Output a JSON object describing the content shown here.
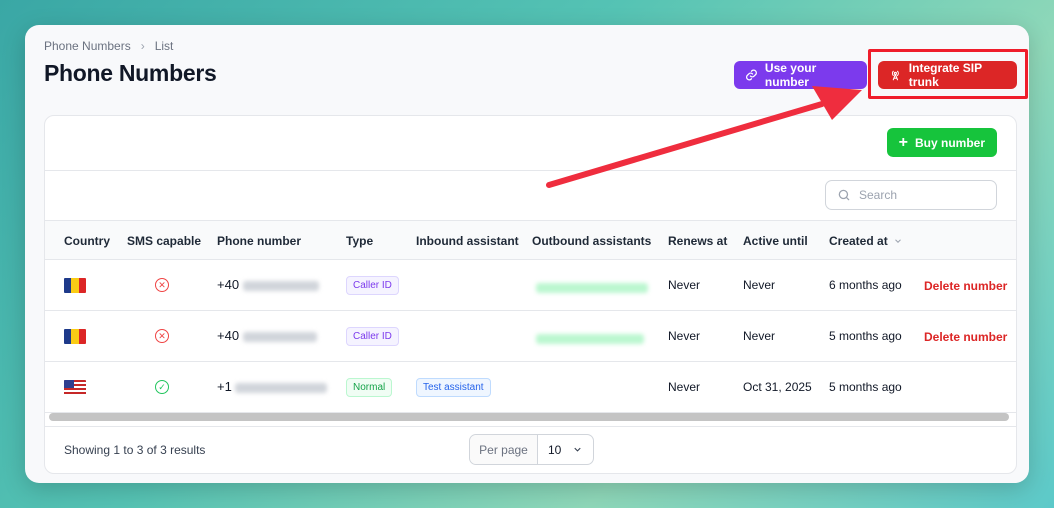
{
  "breadcrumb": {
    "root": "Phone Numbers",
    "current": "List"
  },
  "title": "Phone Numbers",
  "actions": {
    "use_number": "Use your number",
    "integrate_sip": "Integrate SIP trunk",
    "buy_number": "Buy number"
  },
  "search": {
    "placeholder": "Search"
  },
  "table": {
    "headers": [
      "Country",
      "SMS capable",
      "Phone number",
      "Type",
      "Inbound assistant",
      "Outbound assistants",
      "Renews at",
      "Active until",
      "Created at"
    ],
    "rows": [
      {
        "country": "Romania",
        "sms_capable": false,
        "phone_prefix": "+40",
        "type": "Caller ID",
        "inbound": "",
        "renews_at": "Never",
        "active_until": "Never",
        "created_at": "6 months ago",
        "action": "Delete number"
      },
      {
        "country": "Romania",
        "sms_capable": false,
        "phone_prefix": "+40",
        "type": "Caller ID",
        "inbound": "",
        "renews_at": "Never",
        "active_until": "Never",
        "created_at": "5 months ago",
        "action": "Delete number"
      },
      {
        "country": "United States",
        "sms_capable": true,
        "phone_prefix": "+1",
        "type": "Normal",
        "inbound": "Test assistant",
        "renews_at": "Never",
        "active_until": "Oct 31, 2025",
        "created_at": "5 months ago",
        "action": ""
      }
    ]
  },
  "footer": {
    "showing": "Showing 1 to 3 of 3 results",
    "per_page_label": "Per page",
    "per_page_value": "10"
  },
  "colors": {
    "purple": "#7c3aed",
    "red": "#dc2626",
    "green": "#16c43c",
    "highlight": "#ef1d2b"
  }
}
